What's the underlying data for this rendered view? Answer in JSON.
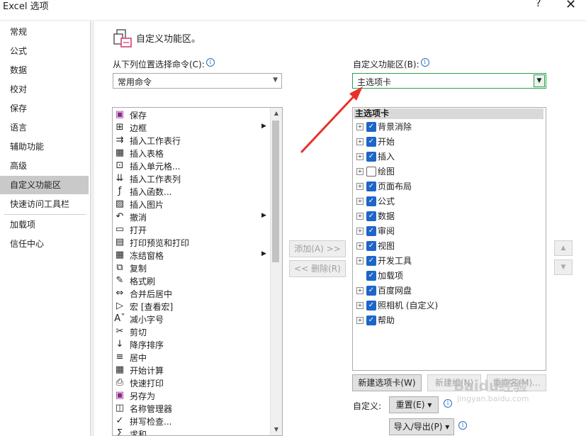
{
  "window": {
    "title": "Excel 选项",
    "help": "?",
    "close": "✕"
  },
  "nav": {
    "items": [
      "常规",
      "公式",
      "数据",
      "校对",
      "保存",
      "语言",
      "辅助功能",
      "高级",
      "自定义功能区",
      "快速访问工具栏",
      "加载项",
      "信任中心"
    ],
    "active": "自定义功能区"
  },
  "header": {
    "title": "自定义功能区。"
  },
  "left": {
    "label": "从下列位置选择命令(C):",
    "dropdown_value": "常用命令",
    "commands": [
      {
        "icon": "save-icon",
        "label": "保存"
      },
      {
        "icon": "border-icon",
        "label": "边框",
        "submenu": true
      },
      {
        "icon": "insert-row-icon",
        "label": "插入工作表行"
      },
      {
        "icon": "insert-table-icon",
        "label": "插入表格"
      },
      {
        "icon": "insert-cells-icon",
        "label": "插入单元格..."
      },
      {
        "icon": "insert-column-icon",
        "label": "插入工作表列"
      },
      {
        "icon": "function-icon",
        "label": "插入函数..."
      },
      {
        "icon": "picture-icon",
        "label": "插入图片"
      },
      {
        "icon": "undo-icon",
        "label": "撤消",
        "submenu": true
      },
      {
        "icon": "open-folder-icon",
        "label": "打开"
      },
      {
        "icon": "print-preview-icon",
        "label": "打印预览和打印"
      },
      {
        "icon": "freeze-panes-icon",
        "label": "冻结窗格",
        "submenu": true
      },
      {
        "icon": "copy-icon",
        "label": "复制"
      },
      {
        "icon": "format-painter-icon",
        "label": "格式刷"
      },
      {
        "icon": "merge-center-icon",
        "label": "合并后居中"
      },
      {
        "icon": "macro-icon",
        "label": "宏 [查看宏]"
      },
      {
        "icon": "decrease-font-icon",
        "label": "减小字号"
      },
      {
        "icon": "cut-icon",
        "label": "剪切"
      },
      {
        "icon": "sort-desc-icon",
        "label": "降序排序"
      },
      {
        "icon": "center-icon",
        "label": "居中"
      },
      {
        "icon": "calculator-icon",
        "label": "开始计算"
      },
      {
        "icon": "quick-print-icon",
        "label": "快速打印"
      },
      {
        "icon": "save-as-icon",
        "label": "另存为"
      },
      {
        "icon": "name-manager-icon",
        "label": "名称管理器"
      },
      {
        "icon": "spelling-icon",
        "label": "拼写检查..."
      },
      {
        "icon": "sum-icon",
        "label": "求和"
      }
    ]
  },
  "middle": {
    "add": "添加(A) >>",
    "remove": "<< 删除(R)"
  },
  "right": {
    "label": "自定义功能区(B):",
    "dropdown_value": "主选项卡",
    "tree_header": "主选项卡",
    "tabs": [
      {
        "label": "背景消除",
        "checked": true,
        "expand": true
      },
      {
        "label": "开始",
        "checked": true,
        "expand": true
      },
      {
        "label": "插入",
        "checked": true,
        "expand": true
      },
      {
        "label": "绘图",
        "checked": false,
        "expand": true
      },
      {
        "label": "页面布局",
        "checked": true,
        "expand": true
      },
      {
        "label": "公式",
        "checked": true,
        "expand": true
      },
      {
        "label": "数据",
        "checked": true,
        "expand": true
      },
      {
        "label": "审阅",
        "checked": true,
        "expand": true
      },
      {
        "label": "视图",
        "checked": true,
        "expand": true
      },
      {
        "label": "开发工具",
        "checked": true,
        "expand": true
      },
      {
        "label": "加载项",
        "checked": true,
        "expand": false
      },
      {
        "label": "百度网盘",
        "checked": true,
        "expand": true
      },
      {
        "label": "照相机 (自定义)",
        "checked": true,
        "expand": true
      },
      {
        "label": "帮助",
        "checked": true,
        "expand": true
      }
    ],
    "new_tab": "新建选项卡(W)",
    "new_group": "新建组(N)",
    "rename": "重命名(M)...",
    "customize_label": "自定义:",
    "reset": "重置(E) ▾",
    "import_export": "导入/导出(P) ▾"
  },
  "watermark": {
    "text": "Baidu经验",
    "url": "jingyan.baidu.com"
  },
  "colors": {
    "accent": "#1e66c8",
    "arrow": "#e8312a",
    "selected_nav": "#c9c9c9"
  }
}
